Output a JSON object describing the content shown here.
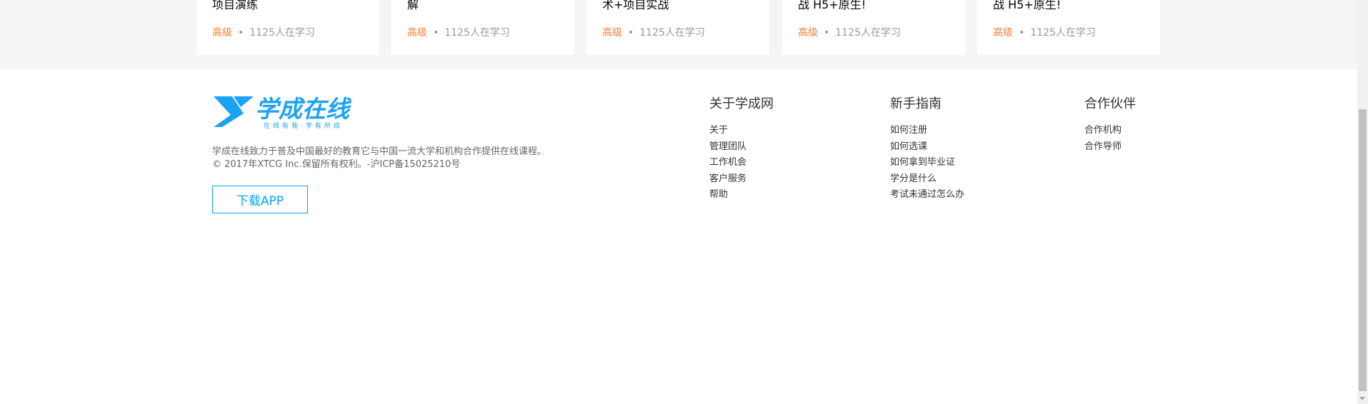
{
  "courses": [
    {
      "title": "项目演练",
      "level": "高级",
      "separator": "•",
      "learners": "1125人在学习"
    },
    {
      "title": "解",
      "level": "高级",
      "separator": "•",
      "learners": "1125人在学习"
    },
    {
      "title": "术+项目实战",
      "level": "高级",
      "separator": "•",
      "learners": "1125人在学习"
    },
    {
      "title": "战 H5+原生!",
      "level": "高级",
      "separator": "•",
      "learners": "1125人在学习"
    },
    {
      "title": "战 H5+原生!",
      "level": "高级",
      "separator": "•",
      "learners": "1125人在学习"
    }
  ],
  "footer": {
    "logo": {
      "main": "学成在线",
      "slogan": "在线有我·学有所成"
    },
    "description_line1": "学成在线致力于普及中国最好的教育它与中国一流大学和机构合作提供在线课程。",
    "description_line2": "© 2017年XTCG Inc.保留所有权利。-沪ICP备15025210号",
    "download_label": "下载APP",
    "columns": [
      {
        "title": "关于学成网",
        "links": [
          "关于",
          "管理团队",
          "工作机会",
          "客户服务",
          "帮助"
        ]
      },
      {
        "title": "新手指南",
        "links": [
          "如何注册",
          "如何选课",
          "如何拿到毕业证",
          "学分是什么",
          "考试未通过怎么办"
        ]
      },
      {
        "title": "合作伙伴",
        "links": [
          "合作机构",
          "合作导师"
        ]
      }
    ]
  },
  "colors": {
    "accent": "#00a4ff",
    "level": "#ff7c2d",
    "band": "#f3f5f7"
  }
}
